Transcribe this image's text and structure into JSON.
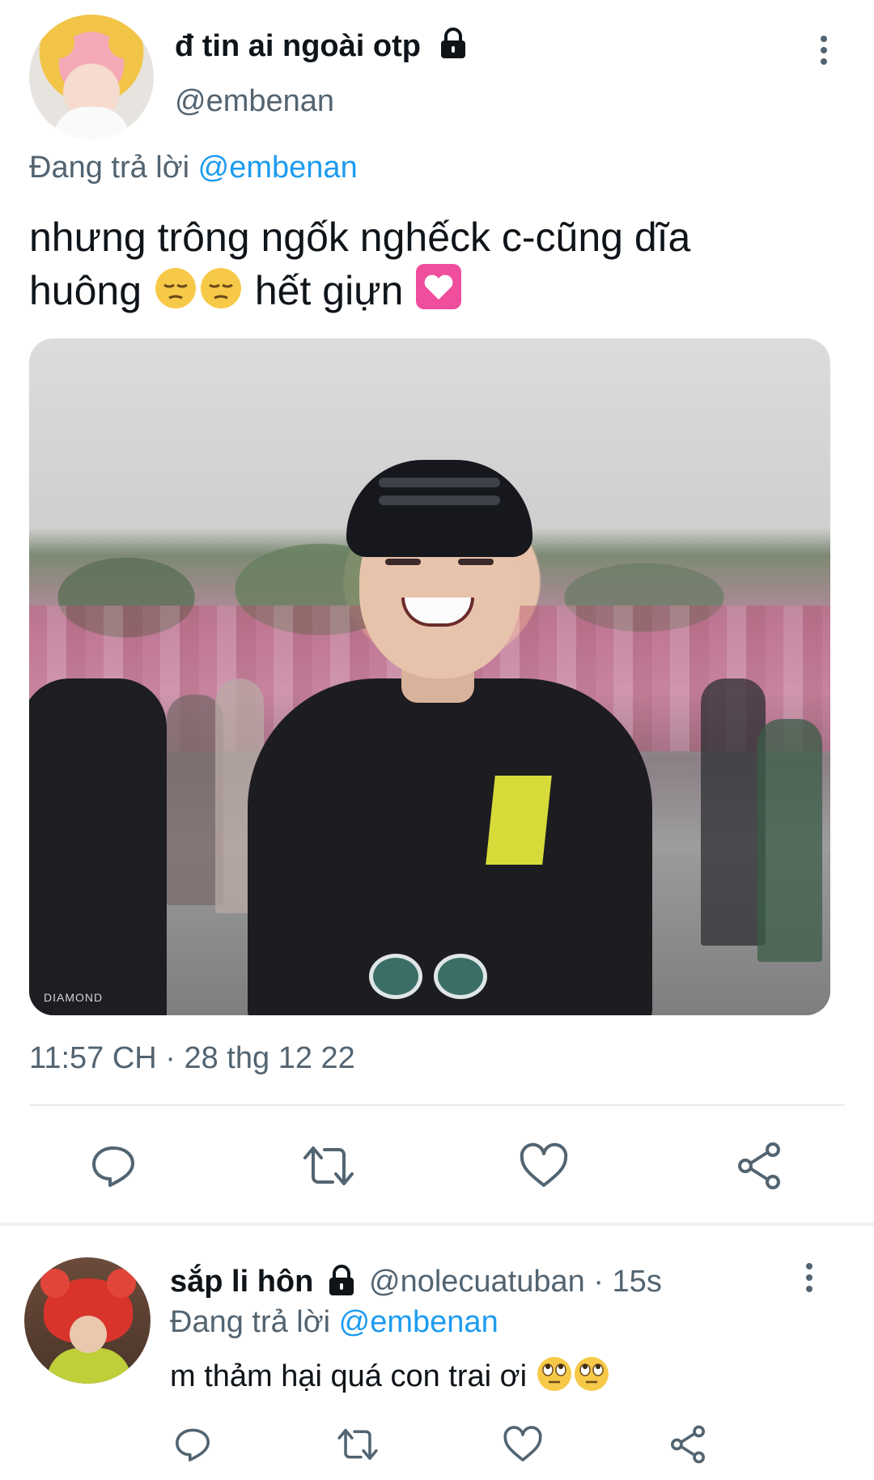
{
  "main_tweet": {
    "display_name": "đ tin ai ngoài otp",
    "handle": "@embenan",
    "replying_prefix": "Đang trả lời",
    "replying_to": "@embenan",
    "text_line1": "nhưng trông ngốk nghếck c-cũng dĩa",
    "text_line2_a": "huông",
    "text_line2_b": "hết giựn",
    "emojis": [
      "pensive-face-emoji",
      "pensive-face-emoji",
      "heart-box-emoji"
    ],
    "media_watermark": "DIAMOND",
    "timestamp": "11:57 CH · 28 thg 12 22"
  },
  "actions": [
    "reply-icon",
    "retweet-icon",
    "like-icon",
    "share-icon"
  ],
  "reply_tweet": {
    "display_name": "sắp li hôn",
    "handle_time": "@nolecuatuban · 15s",
    "replying_prefix": "Đang trả lời",
    "replying_to": "@embenan",
    "text": "m thảm hại quá con trai ơi",
    "emojis": [
      "eye-roll-emoji",
      "eye-roll-emoji"
    ]
  },
  "colors": {
    "text": "#0f1419",
    "secondary": "#536471",
    "accent": "#1d9bf0",
    "divider": "#e6ebee"
  }
}
